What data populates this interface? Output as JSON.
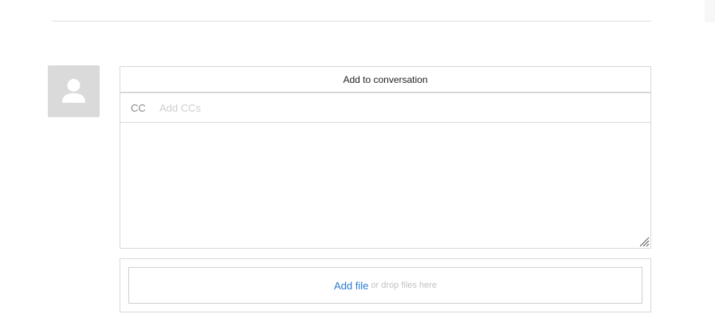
{
  "composer": {
    "add_to_conversation_label": "Add to conversation",
    "cc_label": "CC",
    "cc_placeholder": "Add CCs",
    "message_value": "",
    "attachments": {
      "add_file_label": "Add file",
      "drop_hint": "or drop files here"
    }
  },
  "colors": {
    "link": "#2a7bd1",
    "border": "#d8d8d8",
    "avatar_bg": "#dadada"
  },
  "icons": {
    "avatar": "user-silhouette-icon",
    "resize": "resize-handle-icon"
  }
}
